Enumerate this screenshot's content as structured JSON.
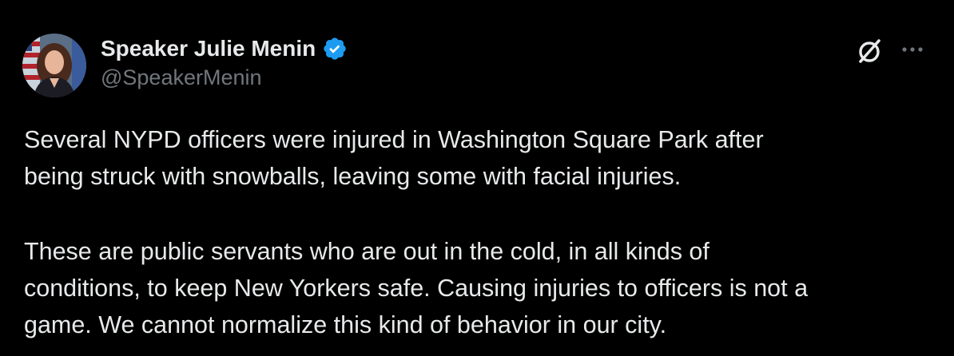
{
  "author": {
    "display_name": "Speaker Julie Menin",
    "handle": "@SpeakerMenin",
    "verified": true,
    "verified_icon": "verified-badge-icon",
    "avatar_icon": "profile-photo"
  },
  "actions": {
    "grok_icon": "grok-icon",
    "more_icon": "more-options-icon"
  },
  "tweet": {
    "paragraph1_lines": [
      "Several NYPD officers were injured in Washington Square Park after",
      "being struck with snowballs, leaving some with facial injuries."
    ],
    "paragraph2_lines": [
      "These are public servants who are out in the cold, in all kinds of",
      "conditions, to keep New Yorkers safe. Causing injuries to officers is not a",
      "game. We cannot normalize this kind of behavior in our city."
    ]
  },
  "colors": {
    "background": "#000000",
    "primary_text": "#e7e9ea",
    "secondary_text": "#71767b",
    "verified_blue": "#1d9bf0"
  }
}
